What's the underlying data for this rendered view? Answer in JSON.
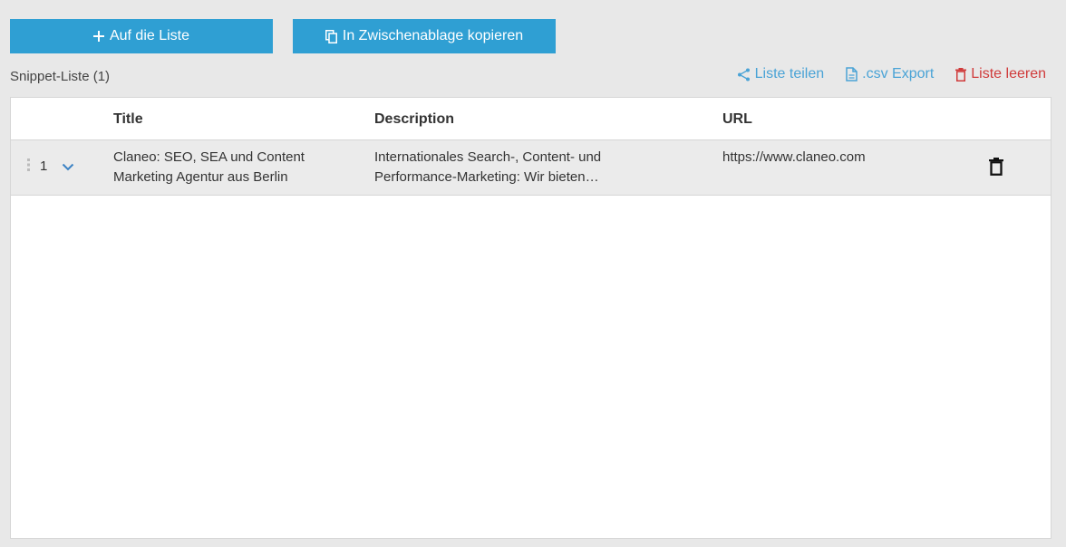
{
  "toolbar": {
    "add_label": "Auf die Liste",
    "copy_label": "In Zwischenablage kopieren"
  },
  "list": {
    "title": "Snippet-Liste (1)"
  },
  "actions": {
    "share_label": "Liste teilen",
    "export_label": ".csv Export",
    "clear_label": "Liste leeren"
  },
  "table": {
    "headers": {
      "title": "Title",
      "description": "Description",
      "url": "URL"
    },
    "rows": [
      {
        "index": "1",
        "title": "Claneo: SEO, SEA und Content Marketing Agentur aus Berlin",
        "description": "Internationales Search-, Content- und Performance-Marketing: Wir bieten…",
        "url": "https://www.claneo.com"
      }
    ]
  },
  "colors": {
    "primary": "#2f9fd3",
    "link": "#4aa3d6",
    "danger": "#d03b3b",
    "background": "#e8e8e8"
  }
}
